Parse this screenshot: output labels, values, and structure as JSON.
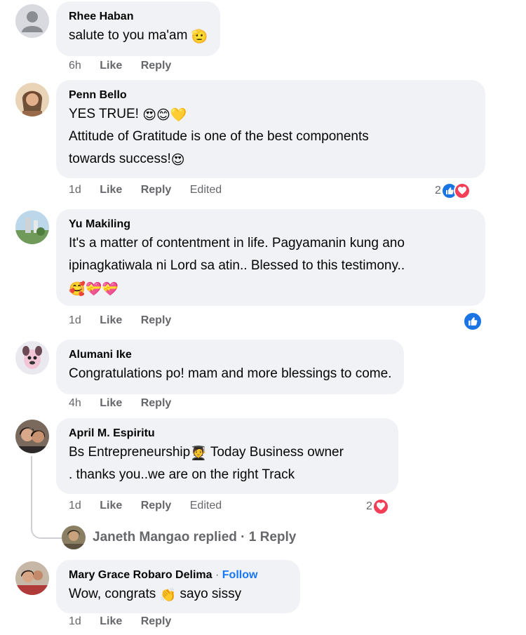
{
  "comments": [
    {
      "author": "Rhee Haban",
      "lines": [
        "salute to you ma'am"
      ],
      "emoji_after": "🫡",
      "time": "6h",
      "like": "Like",
      "reply": "Reply"
    },
    {
      "author": "Penn Bello",
      "line1": "YES TRUE!",
      "line1_emojis": "😍😊💛",
      "line2": "Attitude of Gratitude is one of the best components",
      "line3": "towards success!",
      "line3_emoji": "😍",
      "time": "1d",
      "like": "Like",
      "reply": "Reply",
      "edited": "Edited",
      "reaction_count": "2"
    },
    {
      "author": "Yu Makiling",
      "line1": "It's a matter of contentment in life. Pagyamanin kung ano",
      "line2": "ipinagkatiwala ni Lord sa atin.. Blessed to this testimony..",
      "line3_emojis": "🥰💝💝",
      "time": "1d",
      "like": "Like",
      "reply": "Reply"
    },
    {
      "author": "Alumani Ike",
      "line1": "Congratulations po! mam and more blessings to come.",
      "time": "4h",
      "like": "Like",
      "reply": "Reply"
    },
    {
      "author": "April M. Espiritu",
      "line1a": "Bs Entrepreneurship",
      "line1_emoji": "🧑‍🎓",
      "line1b": "Today Business owner",
      "line2": ". thanks you..we are on the right Track",
      "time": "1d",
      "like": "Like",
      "reply": "Reply",
      "edited": "Edited",
      "reaction_count": "2",
      "replies_text": "Janeth Mangao replied · 1 Reply"
    },
    {
      "author": "Mary Grace Robaro Delima",
      "dot": "·",
      "follow": "Follow",
      "line1a": "Wow, congrats",
      "line1_emoji": "👏",
      "line1b": "sayo sissy",
      "time": "1d",
      "like": "Like",
      "reply": "Reply"
    }
  ],
  "colors": {
    "bubble": "#f0f2f5",
    "meta": "#65676b",
    "like": "#1b74e4",
    "love": "#f33e58",
    "follow": "#1877f2"
  },
  "icons": [
    "default-avatar-icon",
    "like-reaction-icon",
    "love-reaction-icon"
  ]
}
